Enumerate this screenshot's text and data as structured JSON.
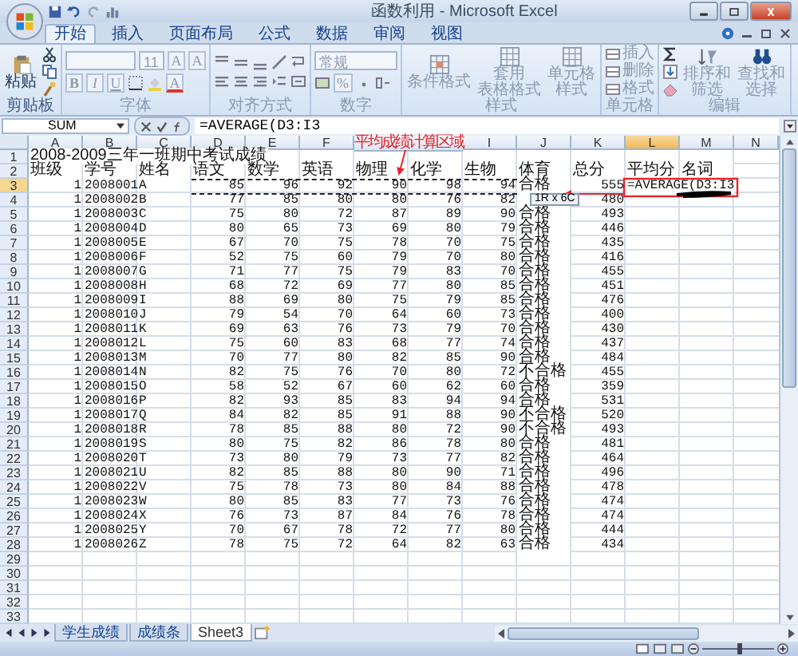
{
  "window": {
    "title": "函数利用 - Microsoft Excel"
  },
  "ribbon": {
    "tabs": [
      {
        "label": "开始",
        "selected": true
      },
      {
        "label": "插入",
        "selected": false
      },
      {
        "label": "页面布局",
        "selected": false
      },
      {
        "label": "公式",
        "selected": false
      },
      {
        "label": "数据",
        "selected": false
      },
      {
        "label": "审阅",
        "selected": false
      },
      {
        "label": "视图",
        "selected": false
      }
    ],
    "groups": [
      {
        "kind": "clipboard",
        "label": "剪贴板",
        "disabled": false,
        "buttons": [
          "粘贴"
        ]
      },
      {
        "kind": "font",
        "label": "字体",
        "disabled": true,
        "size": "11",
        "grow": [
          "A",
          "A"
        ],
        "styles": [
          "B",
          "I",
          "U"
        ],
        "font_color": "A"
      },
      {
        "kind": "align",
        "label": "对齐方式",
        "disabled": true
      },
      {
        "kind": "number",
        "label": "数字",
        "disabled": true,
        "format": "常规",
        "percent": "%"
      },
      {
        "kind": "styles",
        "label": "样式",
        "disabled": true,
        "buttons": [
          [
            "条件格式"
          ],
          [
            "套用",
            "表格格式"
          ],
          [
            "单元格",
            "样式"
          ]
        ]
      },
      {
        "kind": "cells",
        "label": "单元格",
        "disabled": true,
        "buttons": [
          "插入",
          "删除",
          "格式"
        ]
      },
      {
        "kind": "editing",
        "label": "编辑",
        "disabled": true,
        "buttons": [
          [
            "排序和",
            "筛选"
          ],
          [
            "查找和",
            "选择"
          ]
        ]
      }
    ]
  },
  "formula_bar": {
    "name_box": "SUM",
    "formula": "=AVERAGE(D3:I3"
  },
  "sheet": {
    "columns": [
      {
        "label": "A",
        "selected": false
      },
      {
        "label": "B",
        "selected": false
      },
      {
        "label": "C",
        "selected": false
      },
      {
        "label": "D",
        "selected": false
      },
      {
        "label": "E",
        "selected": false
      },
      {
        "label": "F",
        "selected": false
      },
      {
        "selected": false
      },
      {
        "selected": false
      },
      {
        "label": "I",
        "selected": false
      },
      {
        "label": "J",
        "selected": false
      },
      {
        "label": "K",
        "selected": false
      },
      {
        "label": "L",
        "selected": true
      },
      {
        "label": "M",
        "selected": false
      },
      {
        "label": "N",
        "selected": false
      }
    ],
    "title_row": {
      "number": "1",
      "text": "2008-2009三年一班期中考试成绩"
    },
    "header_row": {
      "number": "2",
      "cells": [
        "班级",
        "学号",
        "姓名",
        "语文",
        "数学",
        "英语",
        "物理",
        "化学",
        "生物",
        "体育",
        "总分",
        "平均分",
        "名词"
      ]
    },
    "rows": [
      {
        "number": "3",
        "active": true,
        "referenced": true,
        "formula": "=AVERAGE(D3:I3",
        "cells": [
          "1",
          "2008001",
          "A",
          "85",
          "96",
          "92",
          "90",
          "98",
          "94",
          "合格",
          "555"
        ]
      },
      {
        "number": "4",
        "active": false,
        "referenced": false,
        "cells": [
          "1",
          "2008002",
          "B",
          "77",
          "85",
          "80",
          "80",
          "76",
          "82",
          null,
          "480"
        ]
      },
      {
        "number": "5",
        "active": false,
        "referenced": false,
        "cells": [
          "1",
          "2008003",
          "C",
          "75",
          "80",
          "72",
          "87",
          "89",
          "90",
          "合格",
          "493"
        ]
      },
      {
        "number": "6",
        "active": false,
        "referenced": false,
        "cells": [
          "1",
          "2008004",
          "D",
          "80",
          "65",
          "73",
          "69",
          "80",
          "79",
          "合格",
          "446"
        ]
      },
      {
        "number": "7",
        "active": false,
        "referenced": false,
        "cells": [
          "1",
          "2008005",
          "E",
          "67",
          "70",
          "75",
          "78",
          "70",
          "75",
          "合格",
          "435"
        ]
      },
      {
        "number": "8",
        "active": false,
        "referenced": false,
        "cells": [
          "1",
          "2008006",
          "F",
          "52",
          "75",
          "60",
          "79",
          "70",
          "80",
          "合格",
          "416"
        ]
      },
      {
        "number": "9",
        "active": false,
        "referenced": false,
        "cells": [
          "1",
          "2008007",
          "G",
          "71",
          "77",
          "75",
          "79",
          "83",
          "70",
          "合格",
          "455"
        ]
      },
      {
        "number": "10",
        "active": false,
        "referenced": false,
        "cells": [
          "1",
          "2008008",
          "H",
          "68",
          "72",
          "69",
          "77",
          "80",
          "85",
          "合格",
          "451"
        ]
      },
      {
        "number": "11",
        "active": false,
        "referenced": false,
        "cells": [
          "1",
          "2008009",
          "I",
          "88",
          "69",
          "80",
          "75",
          "79",
          "85",
          "合格",
          "476"
        ]
      },
      {
        "number": "12",
        "active": false,
        "referenced": false,
        "cells": [
          "1",
          "2008010",
          "J",
          "79",
          "54",
          "70",
          "64",
          "60",
          "73",
          "合格",
          "400"
        ]
      },
      {
        "number": "13",
        "active": false,
        "referenced": false,
        "cells": [
          "1",
          "2008011",
          "K",
          "69",
          "63",
          "76",
          "73",
          "79",
          "70",
          "合格",
          "430"
        ]
      },
      {
        "number": "14",
        "active": false,
        "referenced": false,
        "cells": [
          "1",
          "2008012",
          "L",
          "75",
          "60",
          "83",
          "68",
          "77",
          "74",
          "合格",
          "437"
        ]
      },
      {
        "number": "15",
        "active": false,
        "referenced": false,
        "cells": [
          "1",
          "2008013",
          "M",
          "70",
          "77",
          "80",
          "82",
          "85",
          "90",
          "合格",
          "484"
        ]
      },
      {
        "number": "16",
        "active": false,
        "referenced": false,
        "cells": [
          "1",
          "2008014",
          "N",
          "82",
          "75",
          "76",
          "70",
          "80",
          "72",
          "不合格",
          "455"
        ]
      },
      {
        "number": "17",
        "active": false,
        "referenced": false,
        "cells": [
          "1",
          "2008015",
          "O",
          "58",
          "52",
          "67",
          "60",
          "62",
          "60",
          "合格",
          "359"
        ]
      },
      {
        "number": "18",
        "active": false,
        "referenced": false,
        "cells": [
          "1",
          "2008016",
          "P",
          "82",
          "93",
          "85",
          "83",
          "94",
          "94",
          "合格",
          "531"
        ]
      },
      {
        "number": "19",
        "active": false,
        "referenced": false,
        "cells": [
          "1",
          "2008017",
          "Q",
          "84",
          "82",
          "85",
          "91",
          "88",
          "90",
          "不合格",
          "520"
        ]
      },
      {
        "number": "20",
        "active": false,
        "referenced": false,
        "cells": [
          "1",
          "2008018",
          "R",
          "78",
          "85",
          "88",
          "80",
          "72",
          "90",
          "不合格",
          "493"
        ]
      },
      {
        "number": "21",
        "active": false,
        "referenced": false,
        "cells": [
          "1",
          "2008019",
          "S",
          "80",
          "75",
          "82",
          "86",
          "78",
          "80",
          "合格",
          "481"
        ]
      },
      {
        "number": "22",
        "active": false,
        "referenced": false,
        "cells": [
          "1",
          "2008020",
          "T",
          "73",
          "80",
          "79",
          "73",
          "77",
          "82",
          "合格",
          "464"
        ]
      },
      {
        "number": "23",
        "active": false,
        "referenced": false,
        "cells": [
          "1",
          "2008021",
          "U",
          "82",
          "85",
          "88",
          "80",
          "90",
          "71",
          "合格",
          "496"
        ]
      },
      {
        "number": "24",
        "active": false,
        "referenced": false,
        "cells": [
          "1",
          "2008022",
          "V",
          "75",
          "78",
          "73",
          "80",
          "84",
          "88",
          "合格",
          "478"
        ]
      },
      {
        "number": "25",
        "active": false,
        "referenced": false,
        "cells": [
          "1",
          "2008023",
          "W",
          "80",
          "85",
          "83",
          "77",
          "73",
          "76",
          "合格",
          "474"
        ]
      },
      {
        "number": "26",
        "active": false,
        "referenced": false,
        "cells": [
          "1",
          "2008024",
          "X",
          "76",
          "73",
          "87",
          "84",
          "76",
          "78",
          "合格",
          "474"
        ]
      },
      {
        "number": "27",
        "active": false,
        "referenced": false,
        "cells": [
          "1",
          "2008025",
          "Y",
          "70",
          "67",
          "78",
          "72",
          "77",
          "80",
          "合格",
          "444"
        ]
      },
      {
        "number": "28",
        "active": false,
        "referenced": false,
        "cells": [
          "1",
          "2008026",
          "Z",
          "78",
          "75",
          "72",
          "64",
          "82",
          "63",
          "合格",
          "434"
        ]
      }
    ],
    "empty_rows": [
      "29",
      "30",
      "31",
      "32",
      "33"
    ],
    "annotation": "平均成绩计算区域",
    "tooltip": "1R x 6C"
  },
  "sheet_tabs": [
    {
      "label": "学生成绩",
      "selected": false
    },
    {
      "label": "成绩条",
      "selected": false
    },
    {
      "label": "Sheet3",
      "selected": true
    }
  ],
  "status_bar": {
    "zoom": {
      "level": 0.5
    }
  }
}
